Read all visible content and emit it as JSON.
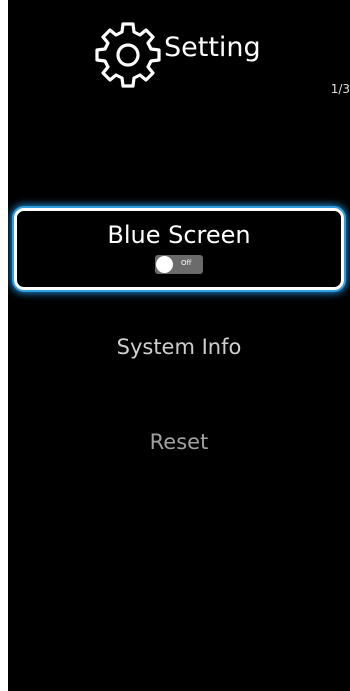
{
  "header": {
    "title": "Setting",
    "icon": "gear-icon",
    "page_indicator": "1/3"
  },
  "menu": {
    "items": [
      {
        "label": "Blue Screen",
        "selected": true,
        "toggle": {
          "state_label": "Off",
          "on": false
        }
      },
      {
        "label": "System Info",
        "selected": false
      },
      {
        "label": "Reset",
        "selected": false
      }
    ]
  },
  "colors": {
    "background": "#000000",
    "selection_glow": "#2f9fe0",
    "text": "#ffffff",
    "toggle_track": "#6b6b6b"
  }
}
